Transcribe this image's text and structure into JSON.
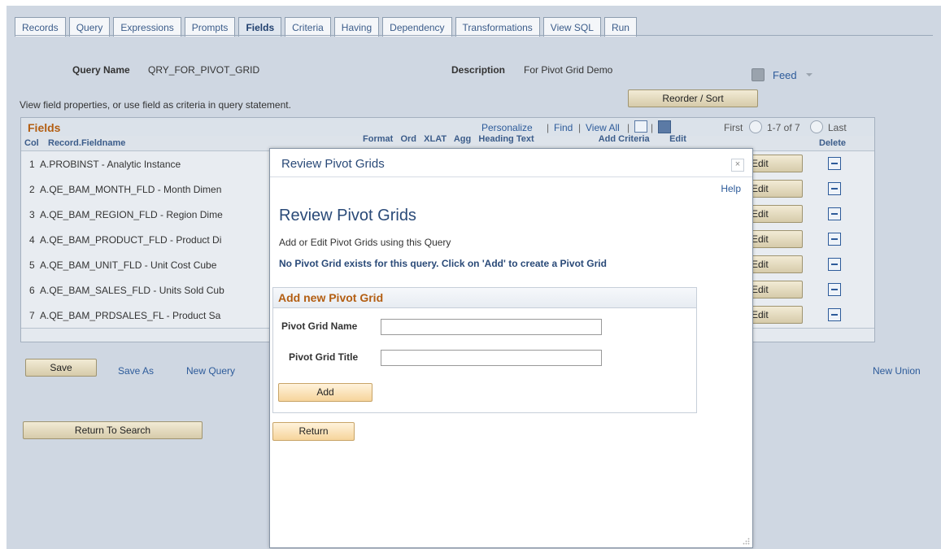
{
  "tabs": [
    "Records",
    "Query",
    "Expressions",
    "Prompts",
    "Fields",
    "Criteria",
    "Having",
    "Dependency",
    "Transformations",
    "View SQL",
    "Run"
  ],
  "active_tab": "Fields",
  "query_name_label": "Query Name",
  "query_name_value": "QRY_FOR_PIVOT_GRID",
  "description_label": "Description",
  "description_value": "For Pivot Grid Demo",
  "feed_label": "Feed",
  "instruction": "View field properties, or use field as criteria in query statement.",
  "reorder_button": "Reorder / Sort",
  "grid": {
    "title": "Fields",
    "personalize": "Personalize",
    "find": "Find",
    "view_all": "View All",
    "first": "First",
    "range": "1-7 of 7",
    "last": "Last",
    "col_header": "Col",
    "field_header": "Record.Fieldname",
    "partial_headers": "Format   Ord   XLAT   Agg   Heading Text                          Add Criteria        Edit",
    "delete_header": "Delete",
    "edit_label": "Edit",
    "rows": [
      {
        "num": "1",
        "field": "A.PROBINST - Analytic Instance"
      },
      {
        "num": "2",
        "field": "A.QE_BAM_MONTH_FLD - Month Dimen"
      },
      {
        "num": "3",
        "field": "A.QE_BAM_REGION_FLD - Region Dime"
      },
      {
        "num": "4",
        "field": "A.QE_BAM_PRODUCT_FLD - Product Di"
      },
      {
        "num": "5",
        "field": "A.QE_BAM_UNIT_FLD - Unit Cost Cube"
      },
      {
        "num": "6",
        "field": "A.QE_BAM_SALES_FLD - Units Sold Cub"
      },
      {
        "num": "7",
        "field": "A.QE_BAM_PRDSALES_FL - Product Sa"
      }
    ]
  },
  "save_button": "Save",
  "save_as_link": "Save As",
  "new_query_link": "New Query",
  "new_union_link": "New Union",
  "return_to_search_button": "Return To Search",
  "modal": {
    "title": "Review Pivot Grids",
    "close": "×",
    "help": "Help",
    "heading": "Review Pivot Grids",
    "subtitle": "Add or Edit Pivot Grids using this Query",
    "notice": "No Pivot Grid exists for this query. Click on 'Add' to create a Pivot Grid",
    "section_title": "Add new Pivot Grid",
    "name_label": "Pivot Grid Name",
    "title_label": "Pivot Grid Title",
    "name_value": "",
    "title_value": "",
    "add_button": "Add",
    "return_button": "Return"
  }
}
